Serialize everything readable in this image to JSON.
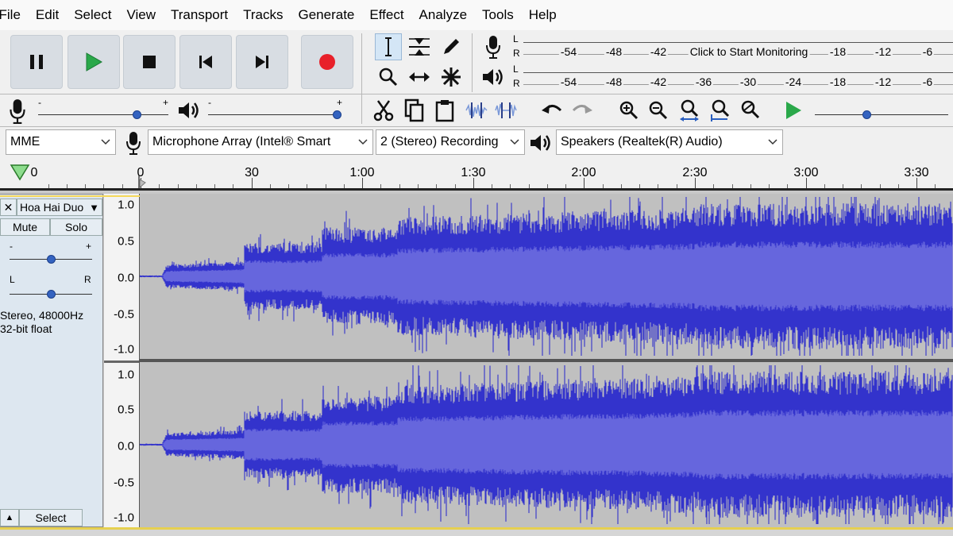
{
  "menu": [
    "File",
    "Edit",
    "Select",
    "View",
    "Transport",
    "Tracks",
    "Generate",
    "Effect",
    "Analyze",
    "Tools",
    "Help"
  ],
  "meters": {
    "record_channels": [
      "L",
      "R"
    ],
    "record_scale": [
      "-54",
      "-48",
      "-42",
      "Click to Start Monitoring",
      "-18",
      "-12",
      "-6"
    ],
    "playback_channels": [
      "L",
      "R"
    ],
    "playback_scale": [
      "-54",
      "-48",
      "-42",
      "-36",
      "-30",
      "-24",
      "-18",
      "-12",
      "-6"
    ]
  },
  "mixer": {
    "minus": "-",
    "plus": "+",
    "recording_volume": 0.78,
    "playback_volume": 1.0,
    "play_at_speed": 0.38
  },
  "devices": {
    "host": "MME",
    "input": "Microphone Array (Intel® Smart",
    "channels": "2 (Stereo) Recording",
    "output": "Speakers (Realtek(R) Audio)"
  },
  "timeline": {
    "labels": [
      "0",
      "0",
      "30",
      "1:00",
      "1:30",
      "2:00",
      "2:30",
      "3:00",
      "3:30"
    ]
  },
  "track": {
    "name": "Hoa Hai Duo",
    "mute_label": "Mute",
    "solo_label": "Solo",
    "gain_minus": "-",
    "gain_plus": "+",
    "pan_left": "L",
    "pan_right": "R",
    "gain": 0.5,
    "pan": 0.5,
    "format_line1": "Stereo, 48000Hz",
    "format_line2": "32-bit float",
    "select_label": "Select",
    "close_symbol": "✕",
    "collapse_symbol": "▲",
    "menu_symbol": "▼"
  },
  "vertical_ruler": {
    "channel1": [
      "1.0",
      "0.5",
      "0.0",
      "-0.5",
      "-1.0"
    ],
    "channel2": [
      "1.0",
      "0.5",
      "0.0",
      "-0.5",
      "-1.0"
    ]
  },
  "colors": {
    "waveform_peak": "#3333cc",
    "waveform_rms": "#6666dd",
    "waveform_background": "#c0c0c0",
    "record_button": "#e8202a",
    "play_button": "#2aa84a",
    "selection_marker": "#e6d050"
  },
  "icons": {
    "pause": "pause-icon",
    "play": "play-icon",
    "stop": "stop-icon",
    "skip_start": "skip-to-start-icon",
    "skip_end": "skip-to-end-icon",
    "record": "record-icon",
    "selection_tool": "selection-tool-icon",
    "envelope_tool": "envelope-tool-icon",
    "draw_tool": "draw-tool-icon",
    "zoom_tool": "zoom-tool-icon",
    "timeshift_tool": "time-shift-tool-icon",
    "multi_tool": "multi-tool-icon"
  }
}
